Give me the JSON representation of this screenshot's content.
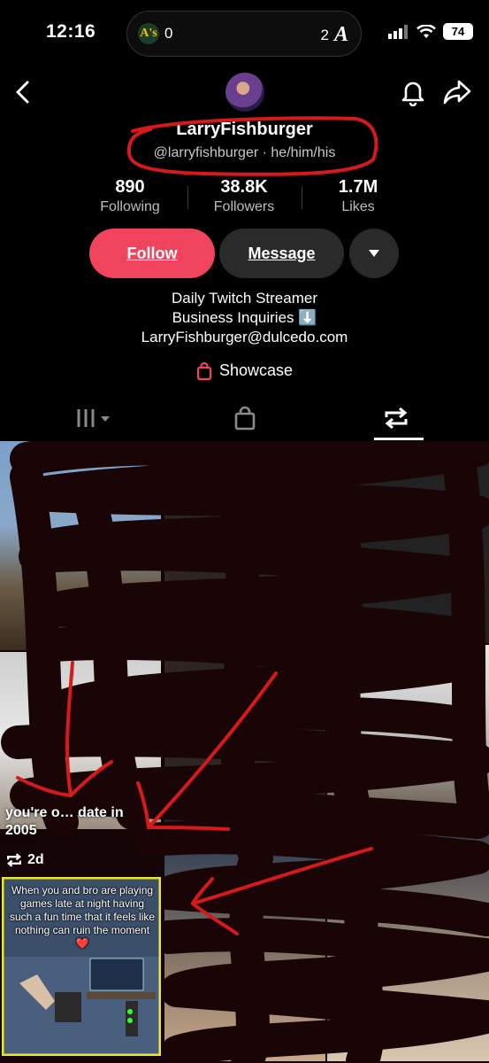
{
  "status_bar": {
    "time": "12:16",
    "left_score": "0",
    "right_score": "2",
    "battery": "74"
  },
  "profile": {
    "username": "LarryFishburger",
    "handle_line": "@larryfishburger · he/him/his",
    "stats": [
      {
        "value": "890",
        "label": "Following"
      },
      {
        "value": "38.8K",
        "label": "Followers"
      },
      {
        "value": "1.7M",
        "label": "Likes"
      }
    ],
    "buttons": {
      "follow": "Follow",
      "message": "Message"
    },
    "bio": [
      "Daily Twitch Streamer",
      "Business Inquiries ⬇️",
      "LarryFishburger@dulcedo.com"
    ],
    "showcase": "Showcase"
  },
  "tabs": [
    {
      "name": "videos",
      "icon": "grid-icon"
    },
    {
      "name": "shop",
      "icon": "bag-icon"
    },
    {
      "name": "reposts",
      "icon": "repost-icon"
    }
  ],
  "grid": {
    "video1_caption": "you're o… date in 2005",
    "video1_age": "2d",
    "video2_caption": "When you and bro are playing games late at night having such a fun time that it feels like nothing can ruin the moment❤️"
  },
  "colors": {
    "accent": "#f0435e",
    "annotation_red": "#d61a1a",
    "annotation_yellow": "#e8e82a",
    "scribble": "#1a0506"
  }
}
